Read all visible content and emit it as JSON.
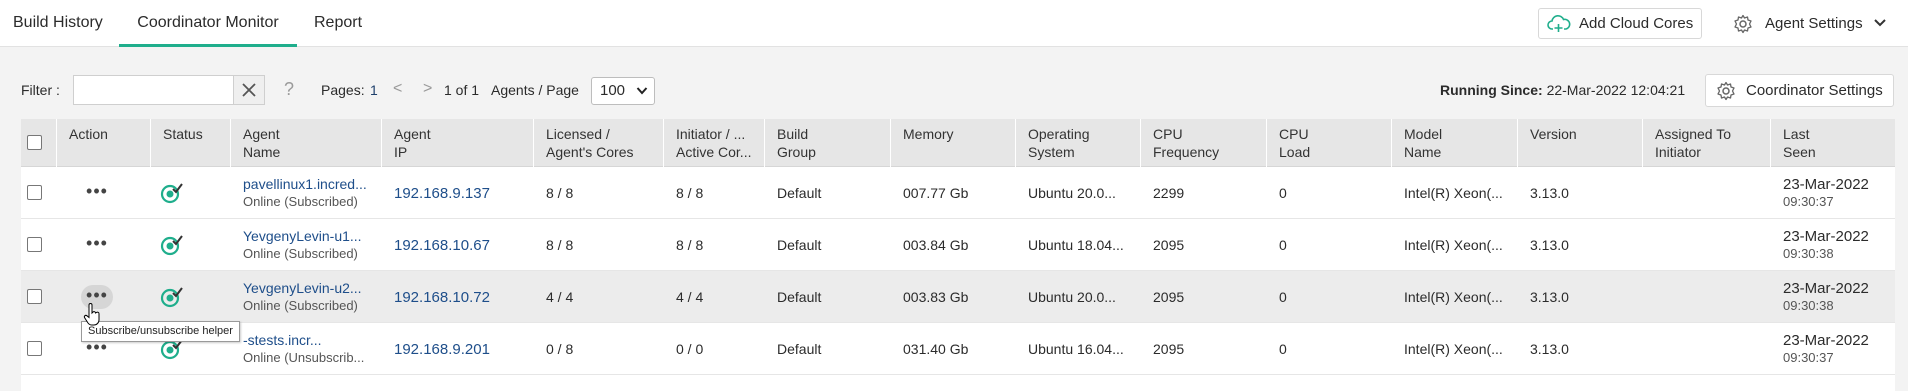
{
  "tabs": [
    {
      "label": "Build History",
      "active": false
    },
    {
      "label": "Coordinator Monitor",
      "active": true
    },
    {
      "label": "Report",
      "active": false
    }
  ],
  "header_actions": {
    "add_cloud_cores": "Add Cloud Cores",
    "agent_settings": "Agent Settings"
  },
  "toolbar": {
    "filter_label": "Filter :",
    "filter_value": "",
    "help": "?",
    "pages_label": "Pages:",
    "current_page": "1",
    "prev": "<",
    "next": ">",
    "of_pages": "1 of 1",
    "agents_per_page_label": "Agents / Page",
    "agents_per_page_value": "100",
    "running_since_label": "Running Since:",
    "running_since_value": "22-Mar-2022 12:04:21",
    "coordinator_settings": "Coordinator Settings"
  },
  "columns": [
    "Action",
    "Status",
    "Agent\nName",
    "Agent\nIP",
    "Licensed /\nAgent's Cores",
    "Initiator / ...\nActive Cor...",
    "Build\nGroup",
    "Memory",
    "Operating\nSystem",
    "CPU\nFrequency",
    "CPU\nLoad",
    "Model\nName",
    "Version",
    "Assigned To\nInitiator",
    "Last\nSeen"
  ],
  "rows": [
    {
      "name": "pavellinux1.incred...",
      "state": "Online (Subscribed)",
      "ip": "192.168.9.137",
      "licensed": "8 / 8",
      "initiator": "8 / 8",
      "group": "Default",
      "memory": "007.77 Gb",
      "os": "Ubuntu 20.0...",
      "freq": "2299",
      "load": "0",
      "model": "Intel(R) Xeon(...",
      "version": "3.13.0",
      "assigned": "",
      "date": "23-Mar-2022",
      "time": "09:30:37"
    },
    {
      "name": "YevgenyLevin-u1...",
      "state": "Online (Subscribed)",
      "ip": "192.168.10.67",
      "licensed": "8 / 8",
      "initiator": "8 / 8",
      "group": "Default",
      "memory": "003.84 Gb",
      "os": "Ubuntu 18.04...",
      "freq": "2095",
      "load": "0",
      "model": "Intel(R) Xeon(...",
      "version": "3.13.0",
      "assigned": "",
      "date": "23-Mar-2022",
      "time": "09:30:38"
    },
    {
      "name": "YevgenyLevin-u2...",
      "state": "Online (Subscribed)",
      "ip": "192.168.10.72",
      "licensed": "4 / 4",
      "initiator": "4 / 4",
      "group": "Default",
      "memory": "003.83 Gb",
      "os": "Ubuntu 20.0...",
      "freq": "2095",
      "load": "0",
      "model": "Intel(R) Xeon(...",
      "version": "3.13.0",
      "assigned": "",
      "date": "23-Mar-2022",
      "time": "09:30:38"
    },
    {
      "name": "-stests.incr...",
      "state": "Online (Unsubscrib...",
      "ip": "192.168.9.201",
      "licensed": "0 / 8",
      "initiator": "0 / 0",
      "group": "Default",
      "memory": "031.40 Gb",
      "os": "Ubuntu 16.04...",
      "freq": "2095",
      "load": "0",
      "model": "Intel(R) Xeon(...",
      "version": "3.13.0",
      "assigned": "",
      "date": "23-Mar-2022",
      "time": "09:30:37"
    }
  ],
  "tooltip": "Subscribe/unsubscribe helper",
  "icons": {
    "add_cloud": "cloud-plus-icon",
    "settings": "gear-icon",
    "status": "status-online-icon",
    "action": "more-dots-icon"
  },
  "colors": {
    "accent": "#1fae8c",
    "link": "#1e4e8a",
    "status": "#1fae8c"
  }
}
